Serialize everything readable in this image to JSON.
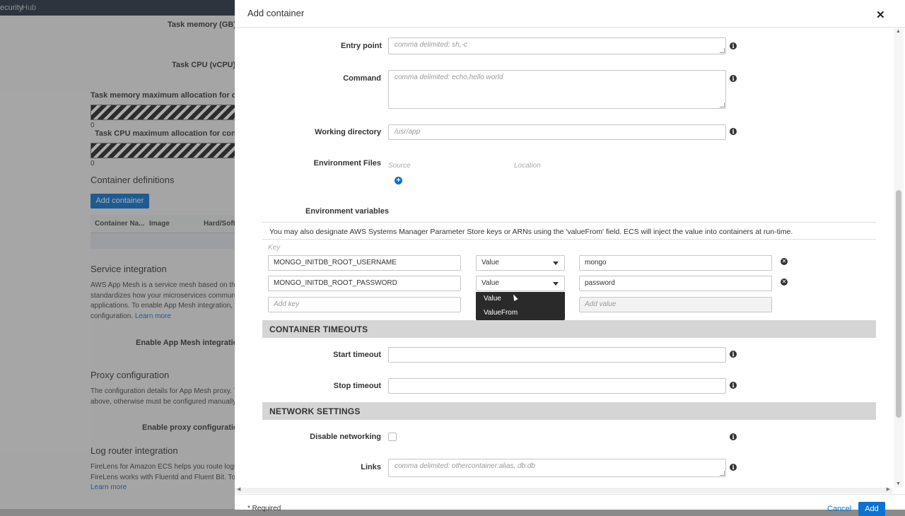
{
  "background": {
    "topbar_prefix": "ecurity",
    "topbar_hub": "Hub",
    "task_memory_label": "Task memory (GB)",
    "task_cpu_label": "Task CPU (vCPU)",
    "task_memory_max_label": "Task memory maximum allocation for containe",
    "task_memory_max_value": "0",
    "task_cpu_max_label": "Task CPU maximum allocation for containers",
    "task_cpu_max_value": "0",
    "container_definitions_heading": "Container definitions",
    "add_container_button": "Add container",
    "table_headers": [
      "Container Na...",
      "Image",
      "Hard/Soft"
    ],
    "service_integration_heading": "Service integration",
    "service_integration_lines": [
      "AWS App Mesh is a service mesh based on the",
      "standardizes how your microservices commun",
      "applications. To enable App Mesh integration, c",
      "configuration."
    ],
    "learn_more": "Learn more",
    "enable_app_mesh_label": "Enable App Mesh integration",
    "proxy_configuration_heading": "Proxy configuration",
    "proxy_configuration_lines": [
      "The configuration details for App Mesh proxy. T",
      "above, otherwise must be configured manually."
    ],
    "enable_proxy_label": "Enable proxy configuration",
    "log_router_heading": "Log router integration",
    "log_router_lines": [
      "FireLens for Amazon ECS helps you route logs",
      "FireLens works with Fluentd and Fluent Bit. To"
    ],
    "learn_more_2": "Learn more"
  },
  "modal": {
    "title": "Add container",
    "close_icon": "close-icon",
    "fields": {
      "entry_point": {
        "label": "Entry point",
        "placeholder": "comma delimited: sh,-c"
      },
      "command": {
        "label": "Command",
        "placeholder": "comma delimited: echo,hello world"
      },
      "working_directory": {
        "label": "Working directory",
        "placeholder": "/usr/app"
      },
      "environment_files": {
        "label": "Environment Files",
        "source_header": "Source",
        "location_header": "Location"
      }
    },
    "environment_variables": {
      "label": "Environment variables",
      "hint": "You may also designate AWS Systems Manager Parameter Store keys or ARNs using the 'valueFrom' field. ECS will inject the value into containers at run-time.",
      "key_header": "Key",
      "rows": [
        {
          "key": "MONGO_INITDB_ROOT_USERNAME",
          "type": "Value",
          "value": "mongo"
        },
        {
          "key": "MONGO_INITDB_ROOT_PASSWORD",
          "type": "Value",
          "value": "password"
        }
      ],
      "add_key_placeholder": "Add key",
      "add_value_placeholder": "Add value",
      "dropdown_options": [
        "Value",
        "ValueFrom"
      ]
    },
    "container_timeouts": {
      "heading": "CONTAINER TIMEOUTS",
      "start_timeout_label": "Start timeout",
      "stop_timeout_label": "Stop timeout"
    },
    "network_settings": {
      "heading": "NETWORK SETTINGS",
      "disable_networking_label": "Disable networking",
      "links_label": "Links",
      "links_placeholder": "comma delimited: othercontainer:alias, db:db"
    },
    "footer": {
      "required_note": "* Required",
      "cancel_label": "Cancel",
      "add_label": "Add"
    }
  },
  "colors": {
    "accent": "#0972d3",
    "section_bg": "#d5d5d5",
    "dropdown_bg": "#2a2a2a"
  }
}
